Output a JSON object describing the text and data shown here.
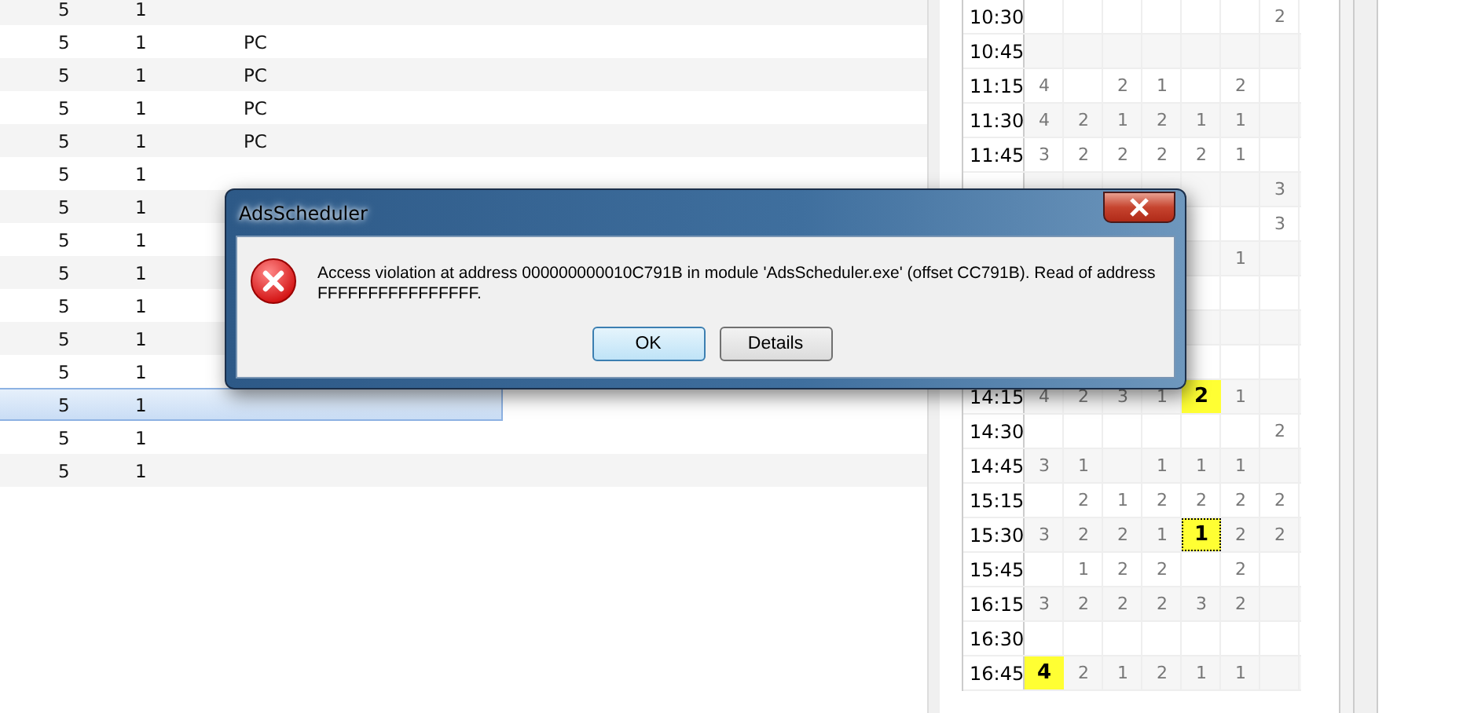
{
  "left_table": {
    "rows": [
      {
        "col_1": "5",
        "col_2": "1",
        "selected": false
      },
      {
        "col_1": "5",
        "col_2": "1",
        "col_3": "PC",
        "selected": false
      },
      {
        "col_1": "5",
        "col_2": "1",
        "col_3": "PC",
        "selected": false
      },
      {
        "col_1": "5",
        "col_2": "1",
        "col_3": "PC",
        "selected": false
      },
      {
        "col_1": "5",
        "col_2": "1",
        "col_3": "PC",
        "selected": false
      },
      {
        "col_1": "5",
        "col_2": "1",
        "selected": false
      },
      {
        "col_1": "5",
        "col_2": "1",
        "selected": false
      },
      {
        "col_1": "5",
        "col_2": "1",
        "selected": false
      },
      {
        "col_1": "5",
        "col_2": "1",
        "selected": false
      },
      {
        "col_1": "5",
        "col_2": "1",
        "selected": false
      },
      {
        "col_1": "5",
        "col_2": "1",
        "selected": false
      },
      {
        "col_1": "5",
        "col_2": "1",
        "selected": false
      },
      {
        "col_1": "5",
        "col_2": "1",
        "selected": true
      },
      {
        "col_1": "5",
        "col_2": "1",
        "selected": false
      },
      {
        "col_1": "5",
        "col_2": "1",
        "selected": false
      }
    ]
  },
  "schedule_grid": {
    "rows": [
      {
        "time": "10:30",
        "cells": [
          null,
          null,
          null,
          null,
          null,
          null,
          {
            "text": "2",
            "highlighted": false,
            "focused": false
          }
        ]
      },
      {
        "time": "10:45",
        "cells": [
          null,
          null,
          null,
          null,
          null,
          null,
          null
        ]
      },
      {
        "time": "11:15",
        "cells": [
          {
            "text": "4",
            "highlighted": false,
            "focused": false
          },
          null,
          {
            "text": "2",
            "highlighted": false,
            "focused": false
          },
          {
            "text": "1",
            "highlighted": false,
            "focused": false
          },
          null,
          {
            "text": "2",
            "highlighted": false,
            "focused": false
          },
          null
        ]
      },
      {
        "time": "11:30",
        "cells": [
          {
            "text": "4",
            "highlighted": false,
            "focused": false
          },
          {
            "text": "2",
            "highlighted": false,
            "focused": false
          },
          {
            "text": "1",
            "highlighted": false,
            "focused": false
          },
          {
            "text": "2",
            "highlighted": false,
            "focused": false
          },
          {
            "text": "1",
            "highlighted": false,
            "focused": false
          },
          {
            "text": "1",
            "highlighted": false,
            "focused": false
          },
          null
        ]
      },
      {
        "time": "11:45",
        "cells": [
          {
            "text": "3",
            "highlighted": false,
            "focused": false
          },
          {
            "text": "2",
            "highlighted": false,
            "focused": false
          },
          {
            "text": "2",
            "highlighted": false,
            "focused": false
          },
          {
            "text": "2",
            "highlighted": false,
            "focused": false
          },
          {
            "text": "2",
            "highlighted": false,
            "focused": false
          },
          {
            "text": "1",
            "highlighted": false,
            "focused": false
          },
          null
        ]
      },
      {
        "cells": [
          null,
          null,
          null,
          null,
          null,
          null,
          {
            "text": "3",
            "highlighted": false,
            "focused": false
          }
        ]
      },
      {
        "cells": [
          null,
          null,
          null,
          null,
          null,
          null,
          {
            "text": "3",
            "highlighted": false,
            "focused": false
          }
        ]
      },
      {
        "cells": [
          null,
          null,
          null,
          null,
          null,
          {
            "text": "1",
            "highlighted": false,
            "focused": false
          },
          null
        ]
      },
      {
        "cells": [
          null,
          null,
          null,
          null,
          null,
          null,
          null
        ]
      },
      {
        "cells": [
          null,
          null,
          null,
          null,
          null,
          null,
          null
        ]
      },
      {
        "cells": [
          null,
          null,
          null,
          null,
          null,
          null,
          null
        ]
      },
      {
        "time": "14:15",
        "cells": [
          {
            "text": "4",
            "highlighted": false,
            "focused": false
          },
          {
            "text": "2",
            "highlighted": false,
            "focused": false
          },
          {
            "text": "3",
            "highlighted": false,
            "focused": false
          },
          {
            "text": "1",
            "highlighted": false,
            "focused": false
          },
          {
            "text": "2",
            "highlighted": true,
            "focused": false
          },
          {
            "text": "1",
            "highlighted": false,
            "focused": false
          },
          null
        ]
      },
      {
        "time": "14:30",
        "cells": [
          null,
          null,
          null,
          null,
          null,
          null,
          {
            "text": "2",
            "highlighted": false,
            "focused": false
          }
        ]
      },
      {
        "time": "14:45",
        "cells": [
          {
            "text": "3",
            "highlighted": false,
            "focused": false
          },
          {
            "text": "1",
            "highlighted": false,
            "focused": false
          },
          null,
          {
            "text": "1",
            "highlighted": false,
            "focused": false
          },
          {
            "text": "1",
            "highlighted": false,
            "focused": false
          },
          {
            "text": "1",
            "highlighted": false,
            "focused": false
          },
          null
        ]
      },
      {
        "time": "15:15",
        "cells": [
          null,
          {
            "text": "2",
            "highlighted": false,
            "focused": false
          },
          {
            "text": "1",
            "highlighted": false,
            "focused": false
          },
          {
            "text": "2",
            "highlighted": false,
            "focused": false
          },
          {
            "text": "2",
            "highlighted": false,
            "focused": false
          },
          {
            "text": "2",
            "highlighted": false,
            "focused": false
          },
          {
            "text": "2",
            "highlighted": false,
            "focused": false
          }
        ]
      },
      {
        "time": "15:30",
        "cells": [
          {
            "text": "3",
            "highlighted": false,
            "focused": false
          },
          {
            "text": "2",
            "highlighted": false,
            "focused": false
          },
          {
            "text": "2",
            "highlighted": false,
            "focused": false
          },
          {
            "text": "1",
            "highlighted": false,
            "focused": false
          },
          {
            "text": "1",
            "highlighted": true,
            "focused": true
          },
          {
            "text": "2",
            "highlighted": false,
            "focused": false
          },
          {
            "text": "2",
            "highlighted": false,
            "focused": false
          }
        ]
      },
      {
        "time": "15:45",
        "cells": [
          null,
          {
            "text": "1",
            "highlighted": false,
            "focused": false
          },
          {
            "text": "2",
            "highlighted": false,
            "focused": false
          },
          {
            "text": "2",
            "highlighted": false,
            "focused": false
          },
          null,
          {
            "text": "2",
            "highlighted": false,
            "focused": false
          },
          null
        ]
      },
      {
        "time": "16:15",
        "cells": [
          {
            "text": "3",
            "highlighted": false,
            "focused": false
          },
          {
            "text": "2",
            "highlighted": false,
            "focused": false
          },
          {
            "text": "2",
            "highlighted": false,
            "focused": false
          },
          {
            "text": "2",
            "highlighted": false,
            "focused": false
          },
          {
            "text": "3",
            "highlighted": false,
            "focused": false
          },
          {
            "text": "2",
            "highlighted": false,
            "focused": false
          },
          null
        ]
      },
      {
        "time": "16:30",
        "cells": [
          null,
          null,
          null,
          null,
          null,
          null,
          null
        ]
      },
      {
        "time": "16:45",
        "cells": [
          {
            "text": "4",
            "highlighted": true,
            "focused": false
          },
          {
            "text": "2",
            "highlighted": false,
            "focused": false
          },
          {
            "text": "1",
            "highlighted": false,
            "focused": false
          },
          {
            "text": "2",
            "highlighted": false,
            "focused": false
          },
          {
            "text": "1",
            "highlighted": false,
            "focused": false
          },
          {
            "text": "1",
            "highlighted": false,
            "focused": false
          },
          null
        ]
      }
    ]
  },
  "dialog": {
    "title": "AdsScheduler",
    "message": "Access violation at address 000000000010C791B in module 'AdsScheduler.exe' (offset CC791B). Read of address FFFFFFFFFFFFFFFF.",
    "buttons": [
      {
        "label": "OK",
        "selected": true
      },
      {
        "label": "Details",
        "selected": false
      }
    ]
  }
}
